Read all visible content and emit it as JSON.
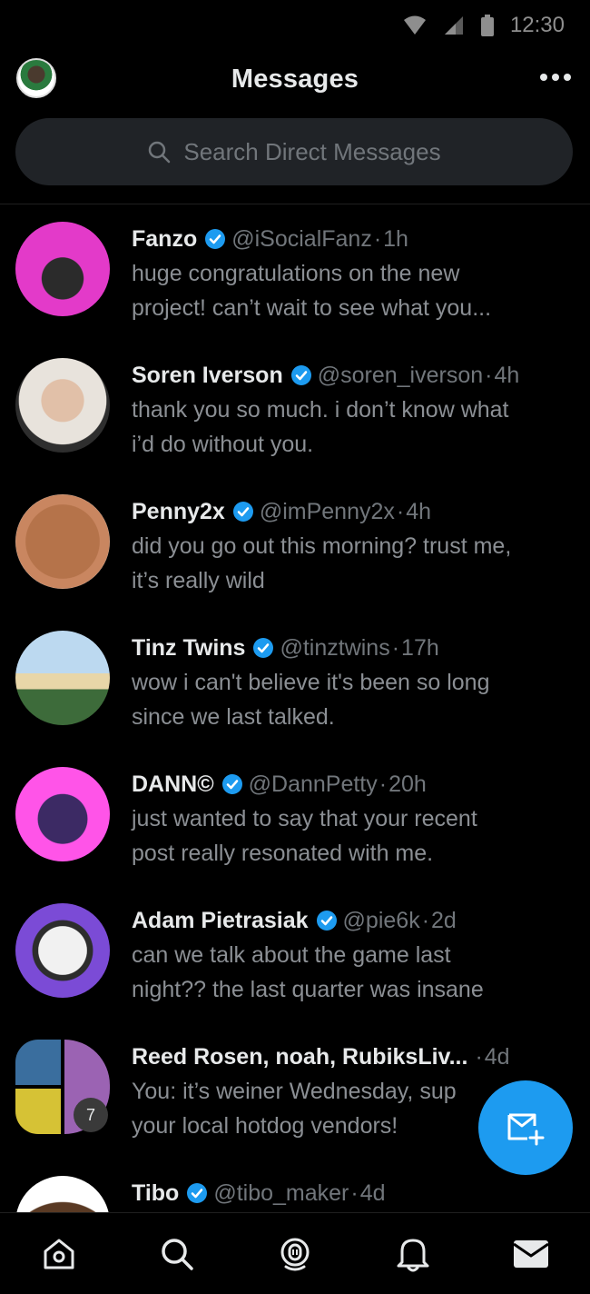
{
  "status_bar": {
    "time": "12:30"
  },
  "header": {
    "title": "Messages"
  },
  "search": {
    "placeholder": "Search Direct Messages"
  },
  "conversations": [
    {
      "name": "Fanzo",
      "verified": true,
      "handle": "@iSocialFanz",
      "time": "1h",
      "message": "huge congratulations on the new\nproject! can’t wait to see what you..."
    },
    {
      "name": "Soren Iverson",
      "verified": true,
      "handle": "@soren_iverson",
      "time": "4h",
      "message": "thank you so much. i don’t know what\ni’d do without you."
    },
    {
      "name": "Penny2x",
      "verified": true,
      "handle": "@imPenny2x",
      "time": "4h",
      "message": "did you go out this morning? trust me,\nit’s really wild"
    },
    {
      "name": "Tinz Twins",
      "verified": true,
      "handle": "@tinztwins",
      "time": "17h",
      "message": "wow i can't believe it's been so long\nsince we last talked."
    },
    {
      "name": "DANN©",
      "verified": true,
      "handle": "@DannPetty",
      "time": "20h",
      "message": "just wanted to say that your recent\npost really resonated with me."
    },
    {
      "name": "Adam Pietrasiak",
      "verified": true,
      "handle": "@pie6k",
      "time": "2d",
      "message": "can we talk about the game last\nnight?? the last quarter was insane"
    },
    {
      "name": "Reed Rosen, noah, RubiksLiv...",
      "verified": false,
      "handle": "",
      "time": "4d",
      "message": "You: it’s weiner Wednesday, sup\nyour local hotdog vendors!",
      "group_count": "7"
    },
    {
      "name": "Tibo",
      "verified": true,
      "handle": "@tibo_maker",
      "time": "4d",
      "message": ""
    }
  ],
  "separator": "·",
  "icons": {
    "header_more": "more-icon",
    "search": "search-icon",
    "fab": "new-message-icon",
    "nav": [
      "home-icon",
      "search-icon",
      "spaces-icon",
      "notifications-icon",
      "messages-icon"
    ]
  },
  "colors": {
    "accent": "#1d9bf0",
    "background": "#000000",
    "secondary_text": "#71767b"
  }
}
